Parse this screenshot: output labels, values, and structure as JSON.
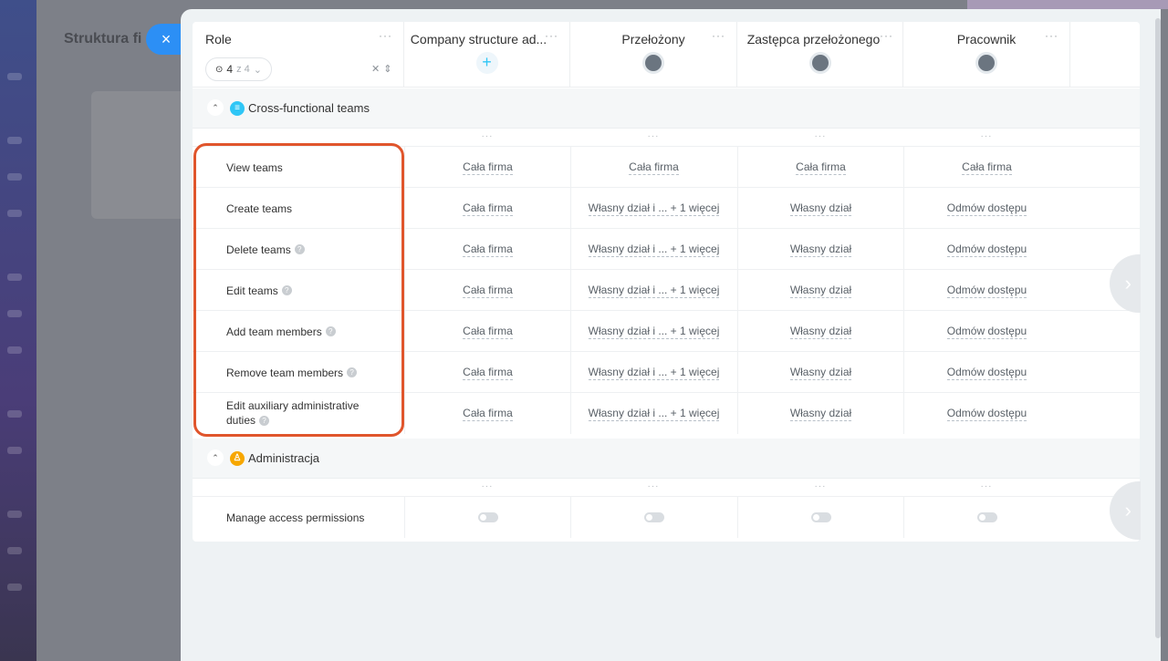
{
  "background": {
    "title": "Struktura fi"
  },
  "close_button": {
    "icon": "close-icon",
    "glyph": "×"
  },
  "header": {
    "role_title": "Role",
    "counter": {
      "current": "4",
      "of_text": "z 4"
    },
    "columns": [
      {
        "title": "Company structure ad...",
        "icon": "plus-icon"
      },
      {
        "title": "Przełożony",
        "icon": "group-avatar-icon"
      },
      {
        "title": "Zastępca przełożonego",
        "icon": "group-avatar-icon"
      },
      {
        "title": "Pracownik",
        "icon": "user-avatar-icon"
      }
    ],
    "menu_glyph": "···"
  },
  "sections": [
    {
      "title": "Cross-functional teams",
      "icon": "teams-icon",
      "color": "#2fc6f6",
      "rows": [
        {
          "label": "View teams",
          "help": false,
          "values": [
            "Cała firma",
            "Cała firma",
            "Cała firma",
            "Cała firma"
          ]
        },
        {
          "label": "Create teams",
          "help": false,
          "values": [
            "Cała firma",
            "Własny dział i ... + 1 więcej",
            "Własny dział",
            "Odmów dostępu"
          ]
        },
        {
          "label": "Delete teams",
          "help": true,
          "values": [
            "Cała firma",
            "Własny dział i ... + 1 więcej",
            "Własny dział",
            "Odmów dostępu"
          ]
        },
        {
          "label": "Edit teams",
          "help": true,
          "values": [
            "Cała firma",
            "Własny dział i ... + 1 więcej",
            "Własny dział",
            "Odmów dostępu"
          ]
        },
        {
          "label": "Add team members",
          "help": true,
          "values": [
            "Cała firma",
            "Własny dział i ... + 1 więcej",
            "Własny dział",
            "Odmów dostępu"
          ]
        },
        {
          "label": "Remove team members",
          "help": true,
          "values": [
            "Cała firma",
            "Własny dział i ... + 1 więcej",
            "Własny dział",
            "Odmów dostępu"
          ]
        },
        {
          "label_line1": "Edit auxiliary administrative",
          "label_line2": "duties",
          "help": true,
          "values": [
            "Cała firma",
            "Własny dział i ... + 1 więcej",
            "Własny dział",
            "Odmów dostępu"
          ]
        }
      ]
    },
    {
      "title": "Administracja",
      "icon": "admin-icon",
      "color": "#f7a700",
      "rows": [
        {
          "label": "Manage access permissions",
          "help": false,
          "toggles": [
            false,
            false,
            false,
            false
          ]
        }
      ]
    }
  ]
}
